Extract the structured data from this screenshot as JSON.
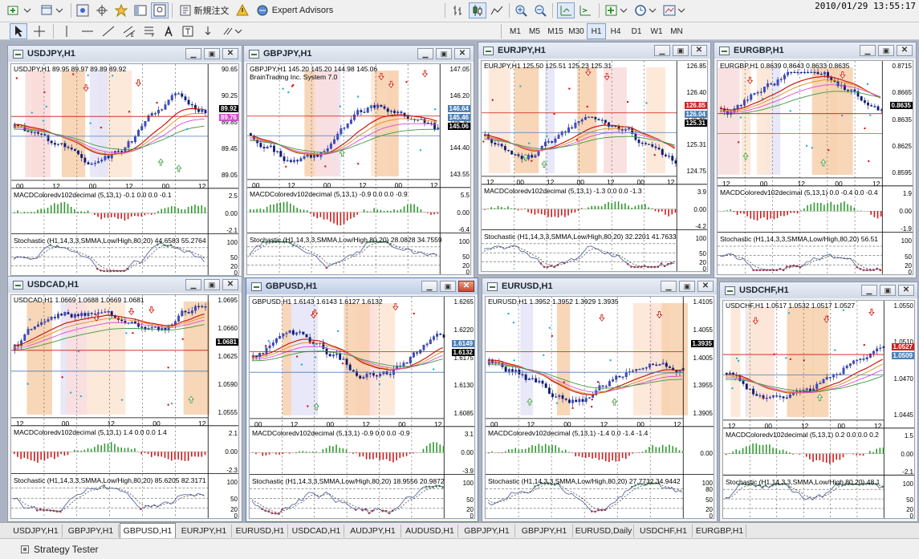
{
  "clock": "2010/01/29 13:55:17",
  "toolbar": {
    "new_order_label": "新規注文",
    "expert_advisors_label": "Expert Advisors",
    "timeframes": [
      "M1",
      "M5",
      "M15",
      "M30",
      "H1",
      "H4",
      "D1",
      "W1",
      "MN"
    ],
    "active_timeframe": "H1"
  },
  "windows": [
    {
      "id": "usdjpy",
      "title": "USDJPY,H1",
      "active": false,
      "header": "USDJPY,H1  89.95 89.97 89.89 89.92",
      "header2": "",
      "price_labels": [
        "90.65",
        "90.25",
        "89.85",
        "89.45",
        "89.05"
      ],
      "price_boxes": [
        {
          "text": "89.92",
          "color": "#000000"
        },
        {
          "text": "89.76",
          "color": "#d24bd2"
        }
      ],
      "time_labels": [
        "00",
        "12",
        "00",
        "12",
        "00",
        "12"
      ],
      "macd_header": "MACDColoredv102decimal (5,13,1) -0.1 0.0 0.0 -0.1",
      "macd_levels": [
        "2.5",
        "0.00",
        "-2.1"
      ],
      "stoch_header": "Stochastic (H1,14,3,3,SMMA,Low/High,80,20) 44.6583 55.2764",
      "stoch_levels": [
        "100",
        "50",
        "20",
        "0"
      ]
    },
    {
      "id": "gbpjpy",
      "title": "GBPJPY,H1",
      "active": false,
      "header": "GBPJPY,H1  145.20 145.20 144.98 145.06",
      "header2": "BrainTrading Inc. System 7.0",
      "price_labels": [
        "147.05",
        "146.20",
        "145.30",
        "144.40",
        "143.55"
      ],
      "price_boxes": [
        {
          "text": "146.64",
          "color": "#4a7fb8"
        },
        {
          "text": "145.46",
          "color": "#4a7fb8"
        },
        {
          "text": "145.06",
          "color": "#000000"
        }
      ],
      "time_labels": [
        "00",
        "12",
        "00",
        "12",
        "00",
        "12"
      ],
      "macd_header": "MACDColoredv102decimal (5,13,1) -0.9 0.0 0.0 -0.9",
      "macd_levels": [
        "5.5",
        "0.00",
        "-6.4"
      ],
      "stoch_header": "Stochastic (H1,14,3,3,SMMA,Low/High,80,20) 28.0828 34.7559",
      "stoch_levels": [
        "100",
        "50",
        "20",
        "0"
      ]
    },
    {
      "id": "eurjpy",
      "title": "EURJPY,H1",
      "active": false,
      "header": "EURJPY,H1  125.50 125.51 125.23 125.31",
      "header2": "",
      "price_labels": [
        "126.85",
        "126.40",
        "125.85",
        "125.31",
        "124.75"
      ],
      "price_boxes": [
        {
          "text": "126.85",
          "color": "#d02020"
        },
        {
          "text": "126.04",
          "color": "#4a7fb8"
        },
        {
          "text": "125.31",
          "color": "#000000"
        }
      ],
      "time_labels": [
        "12",
        "00",
        "12",
        "00",
        "12",
        "00",
        "12"
      ],
      "macd_header": "MACDColoredv102decimal (5,13,1) -1.3 0.0 0.0 -1.3",
      "macd_levels": [
        "3.9",
        "0.00",
        "-4.2"
      ],
      "stoch_header": "Stochastic (H1,14,3,3,SMMA,Low/High,80,20) 32.2201 41.7633",
      "stoch_levels": [
        "100",
        "50",
        "20",
        "0"
      ]
    },
    {
      "id": "eurgbp",
      "title": "EURGBP,H1",
      "active": false,
      "header": "EURGBP,H1  0.8639 0.8643 0.8633 0.8635",
      "header2": "",
      "price_labels": [
        "0.8715",
        "0.8665",
        "0.8635",
        "0.8625",
        "0.8595"
      ],
      "price_boxes": [
        {
          "text": "0.8635",
          "color": "#000000"
        }
      ],
      "time_labels": [
        "12",
        "00",
        "12",
        "00",
        "12"
      ],
      "macd_header": "MACDColoredv102decimal (5,13,1) 0.0 -0.4 0.0 -0.4",
      "macd_levels": [
        "1.9",
        "0.00",
        "-1.9"
      ],
      "stoch_header": "Stochastic (H1,14,3,3,SMMA,Low/High,80,20) 56.51",
      "stoch_levels": [
        "100",
        "50",
        "20",
        "0"
      ]
    },
    {
      "id": "usdcad",
      "title": "USDCAD,H1",
      "active": false,
      "header": "USDCAD,H1  1.0669 1.0688 1.0669 1.0681",
      "header2": "",
      "price_labels": [
        "1.0695",
        "1.0660",
        "1.0625",
        "1.0590",
        "1.0555"
      ],
      "price_boxes": [
        {
          "text": "1.0681",
          "color": "#000000"
        }
      ],
      "time_labels": [
        "12",
        "00",
        "12",
        "00",
        "12"
      ],
      "macd_header": "MACDColoredv102decimal (5,13,1) 1.4 0.0 0.0 1.4",
      "macd_levels": [
        "2.1",
        "0.00",
        "-2.3"
      ],
      "stoch_header": "Stochastic (H1,14,3,3,SMMA,Low/High,80,20) 85.6205 82.3171",
      "stoch_levels": [
        "100",
        "50",
        "20",
        "0"
      ]
    },
    {
      "id": "gbpusd",
      "title": "GBPUSD,H1",
      "active": true,
      "header": "GBPUSD,H1  1.6143 1.6143 1.6127 1.6132",
      "header2": "",
      "price_labels": [
        "1.6265",
        "1.6220",
        "1.6175",
        "1.6130",
        "1.6085"
      ],
      "price_boxes": [
        {
          "text": "1.6149",
          "color": "#4a7fb8"
        },
        {
          "text": "1.6132",
          "color": "#000000"
        }
      ],
      "time_labels": [
        "00",
        "12",
        "00",
        "12",
        "00",
        "12"
      ],
      "macd_header": "MACDColoredv102decimal (5,13,1) -0.9 0.0 0.0 -0.9",
      "macd_levels": [
        "3.1",
        "0.00",
        "-3.9"
      ],
      "stoch_header": "Stochastic (H1,14,3,3,SMMA,Low/High,80,20) 18.9556 20.9872",
      "stoch_levels": [
        "100",
        "50",
        "20",
        "0"
      ]
    },
    {
      "id": "eurusd",
      "title": "EURUSD,H1",
      "active": false,
      "header": "EURUSD,H1  1.3952 1.3952 1.3929 1.3935",
      "header2": "",
      "price_labels": [
        "1.4105",
        "1.4055",
        "1.4005",
        "1.3955",
        "1.3905"
      ],
      "price_boxes": [
        {
          "text": "1.3935",
          "color": "#000000"
        }
      ],
      "time_labels": [
        "00",
        "12",
        "00",
        "12",
        "00",
        "12"
      ],
      "macd_header": "MACDColoredv102decimal (5,13,1) -1.4 0.0 -1.4 -1.4",
      "macd_levels": [
        "0.00"
      ],
      "stoch_header": "Stochastic (H1,14,3,3,SMMA,Low/High,80,20) 27.7732 34.9442",
      "stoch_levels": [
        "100",
        "80",
        "50",
        "20",
        "0"
      ]
    },
    {
      "id": "usdchf",
      "title": "USDCHF,H1",
      "active": false,
      "header": "USDCHF,H1  1.0517 1.0532 1.0517 1.0527",
      "header2": "",
      "price_labels": [
        "1.0550",
        "1.0510",
        "1.0470",
        "1.0445"
      ],
      "price_boxes": [
        {
          "text": "1.0527",
          "color": "#d02020"
        },
        {
          "text": "1.0509",
          "color": "#4a7fb8"
        }
      ],
      "time_labels": [
        "12",
        "00",
        "12",
        "00",
        "12"
      ],
      "macd_header": "MACDColoredv102decimal (5,13,1) 0.2 0.0 0.0 0.2",
      "macd_levels": [
        "1.5",
        "0.00",
        "-2.1"
      ],
      "stoch_header": "Stochastic (H1,14,3,3,SMMA,Low/High,80,20) 48.1",
      "stoch_levels": [
        "100",
        "50",
        "20",
        "0"
      ]
    }
  ],
  "tabs": [
    "USDJPY,H1",
    "GBPJPY,H1",
    "GBPUSD,H1",
    "EURJPY,H1",
    "EURUSD,H1",
    "USDCAD,H1",
    "AUDJPY,H1",
    "AUDUSD,H1",
    "GBPJPY,H1",
    "GBPJPY,H1",
    "EURUSD,Daily",
    "USDCHF,H1",
    "EURGBP,H1"
  ],
  "active_tab": "GBPUSD,H1",
  "strategy_tester_label": "Strategy Tester"
}
